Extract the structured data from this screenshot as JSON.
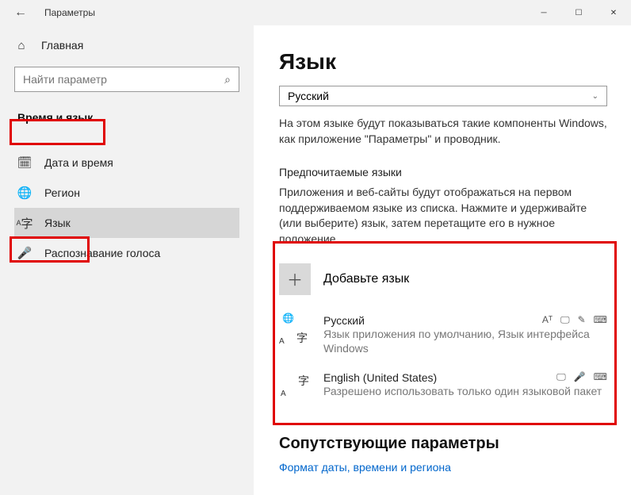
{
  "window": {
    "title": "Параметры"
  },
  "sidebar": {
    "home": "Главная",
    "search_placeholder": "Найти параметр",
    "category": "Время и язык",
    "items": [
      {
        "label": "Дата и время"
      },
      {
        "label": "Регион"
      },
      {
        "label": "Язык"
      },
      {
        "label": "Распознавание голоса"
      }
    ]
  },
  "main": {
    "heading": "Язык",
    "display_lang_selected": "Русский",
    "display_lang_desc": "На этом языке будут показываться такие компоненты Windows, как приложение \"Параметры\" и проводник.",
    "preferred_title": "Предпочитаемые языки",
    "preferred_desc": "Приложения и веб-сайты будут отображаться на первом поддерживаемом языке из списка. Нажмите и удерживайте (или выберите) язык, затем перетащите его в нужное положение.",
    "add_language": "Добавьте язык",
    "languages": [
      {
        "name": "Русский",
        "sub": "Язык приложения по умолчанию, Язык интерфейса Windows"
      },
      {
        "name": "English (United States)",
        "sub": "Разрешено использовать только один языковой пакет"
      }
    ],
    "related_title": "Сопутствующие параметры",
    "related_link": "Формат даты, времени и региона"
  }
}
